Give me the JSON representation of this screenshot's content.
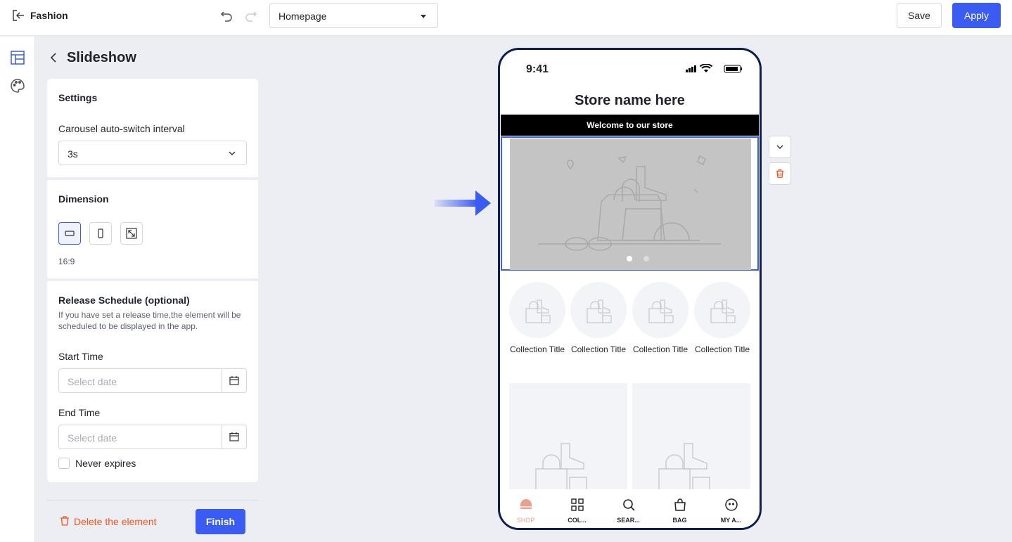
{
  "header": {
    "app_name": "Fashion",
    "page_select_value": "Homepage",
    "save_label": "Save",
    "apply_label": "Apply"
  },
  "rail": {
    "items": [
      {
        "icon": "layout-icon",
        "active": true
      },
      {
        "icon": "palette-icon",
        "active": false
      }
    ]
  },
  "panel": {
    "title": "Slideshow",
    "settings": {
      "title": "Settings",
      "interval_label": "Carousel auto-switch interval",
      "interval_value": "3s"
    },
    "dimension": {
      "title": "Dimension",
      "options": [
        "landscape",
        "portrait",
        "fit"
      ],
      "selected": "landscape",
      "ratio": "16:9"
    },
    "schedule": {
      "title": "Release Schedule (optional)",
      "description": "If you have set a release time,the element will be scheduled to be displayed in the app.",
      "start_label": "Start Time",
      "start_placeholder": "Select date",
      "end_label": "End Time",
      "end_placeholder": "Select date",
      "never_expires_label": "Never expires",
      "never_expires_checked": false
    },
    "footer": {
      "delete_label": "Delete the element",
      "finish_label": "Finish"
    }
  },
  "preview": {
    "status_time": "9:41",
    "store_name": "Store name here",
    "announcement": "Welcome to our store",
    "slide_dots": 2,
    "active_dot": 1,
    "collections": [
      {
        "title": "Collection Title"
      },
      {
        "title": "Collection Title"
      },
      {
        "title": "Collection Title"
      },
      {
        "title": "Collection Title"
      }
    ],
    "tabs": [
      {
        "label": "SHOP",
        "icon": "home-icon",
        "active": true
      },
      {
        "label": "COL...",
        "icon": "grid-icon",
        "active": false
      },
      {
        "label": "SEAR...",
        "icon": "search-icon",
        "active": false
      },
      {
        "label": "BAG",
        "icon": "bag-icon",
        "active": false
      },
      {
        "label": "MY A...",
        "icon": "account-icon",
        "active": false
      }
    ]
  },
  "colors": {
    "accent": "#3a5cf2",
    "danger": "#f5541f",
    "phone_frame": "#0d1f4f",
    "active_tab": "#e8a190"
  }
}
